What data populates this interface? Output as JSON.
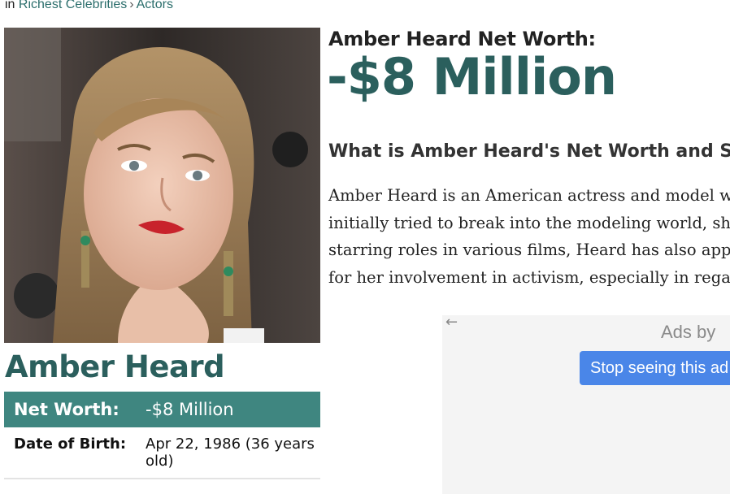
{
  "breadcrumb": {
    "prefix": "in",
    "category": "Richest Celebrities",
    "separator": "›",
    "subcategory": "Actors"
  },
  "profile": {
    "name": "Amber Heard",
    "net_worth_label": "Net Worth:",
    "net_worth_value": "-$8 Million",
    "dob_label": "Date of Birth:",
    "dob_value": "Apr 22, 1986 (36 years old)"
  },
  "headline": {
    "title": "Amber Heard Net Worth:",
    "amount": "-$8 Million"
  },
  "article": {
    "question": "What is Amber Heard's Net Worth and Sa",
    "lines": [
      "Amber Heard is an American actress and model who",
      "initially tried to break into the modeling world, she l",
      "starring roles in various films, Heard has also appear",
      "for her involvement in activism, especially in regard"
    ]
  },
  "ad": {
    "back_icon": "←",
    "ads_by": "Ads by",
    "stop_button": "Stop seeing this ad"
  },
  "colors": {
    "accent": "#2b5f5d",
    "table_header": "#3f8680",
    "link": "#2b6e6c",
    "ad_button": "#4a86e8"
  }
}
